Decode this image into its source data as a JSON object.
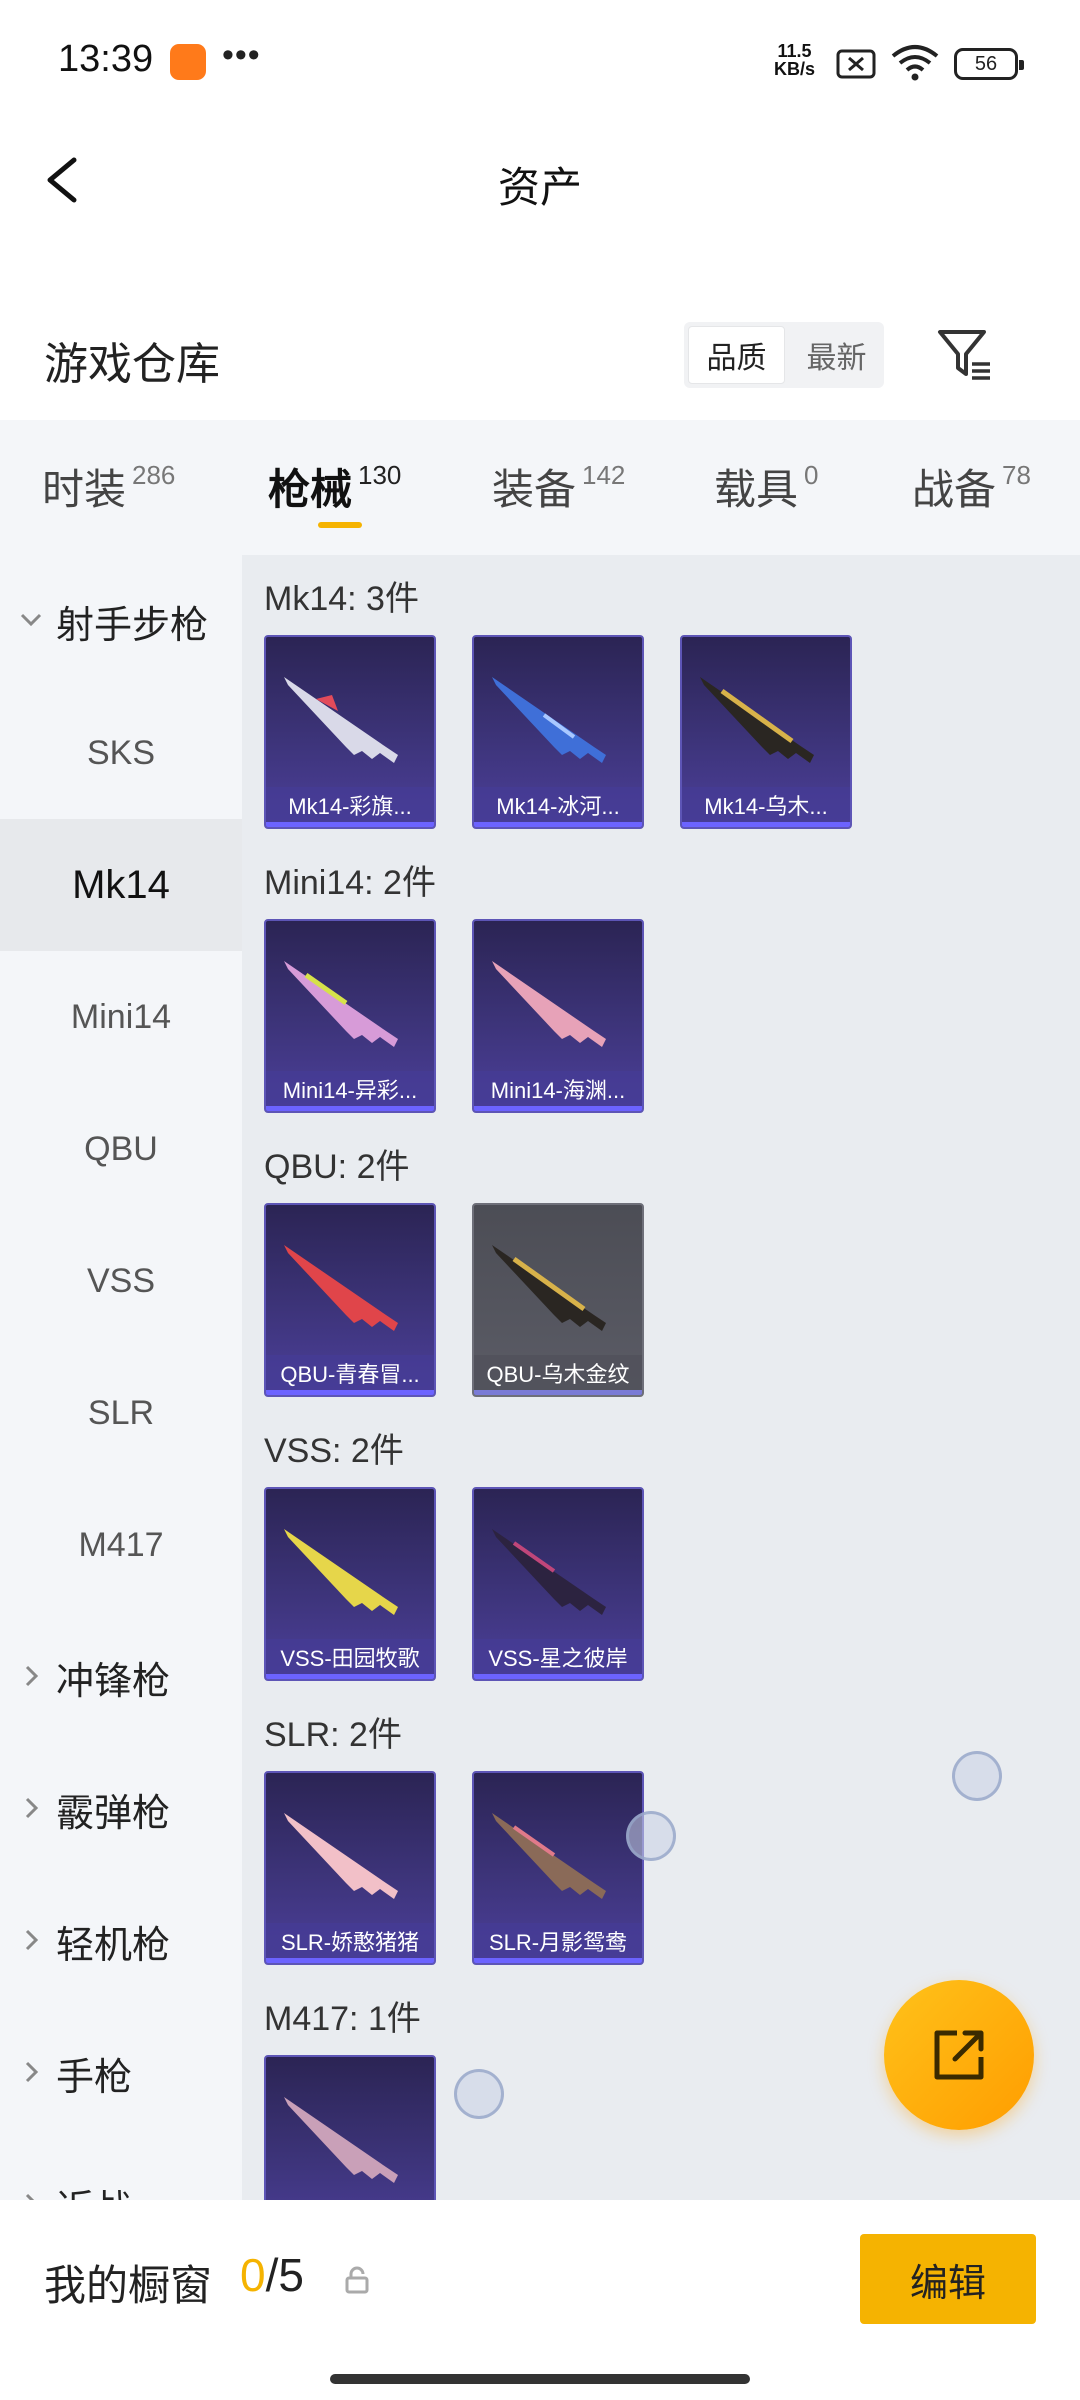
{
  "status_bar": {
    "time": "13:39",
    "more": "•••",
    "net_speed_value": "11.5",
    "net_speed_unit": "KB/s",
    "battery": "56"
  },
  "header": {
    "title": "资产"
  },
  "section": {
    "title": "游戏仓库",
    "sort_options": [
      "品质",
      "最新"
    ],
    "sort_active": "品质"
  },
  "tabs": [
    {
      "label": "时装",
      "count": "286"
    },
    {
      "label": "枪械",
      "count": "130"
    },
    {
      "label": "装备",
      "count": "142"
    },
    {
      "label": "载具",
      "count": "0"
    },
    {
      "label": "战备",
      "count": "78"
    }
  ],
  "sidebar": {
    "category": "射手步枪",
    "items": [
      "SKS",
      "Mk14",
      "Mini14",
      "QBU",
      "VSS",
      "SLR",
      "M417"
    ],
    "active_item": "Mk14",
    "other_categories": [
      "冲锋枪",
      "霰弹枪",
      "轻机枪",
      "手枪",
      "近战"
    ]
  },
  "groups": [
    {
      "title": "Mk14: 3件",
      "items": [
        "Mk14-彩旗...",
        "Mk14-冰河...",
        "Mk14-乌木..."
      ]
    },
    {
      "title": "Mini14: 2件",
      "items": [
        "Mini14-异彩...",
        "Mini14-海渊..."
      ]
    },
    {
      "title": "QBU: 2件",
      "items": [
        "QBU-青春冒...",
        "QBU-乌木金纹"
      ]
    },
    {
      "title": "VSS: 2件",
      "items": [
        "VSS-田园牧歌",
        "VSS-星之彼岸"
      ]
    },
    {
      "title": "SLR: 2件",
      "items": [
        "SLR-娇憨猪猪",
        "SLR-月影鸳鸯"
      ]
    },
    {
      "title": "M417: 1件",
      "items": [
        ""
      ]
    }
  ],
  "showcase": {
    "label": "我的橱窗",
    "current": "0",
    "total": "/5",
    "edit_label": "编辑"
  },
  "colors": {
    "accent": "#f5b301",
    "card_purple": "#3d347a",
    "card_gray": "#5b5c66"
  }
}
